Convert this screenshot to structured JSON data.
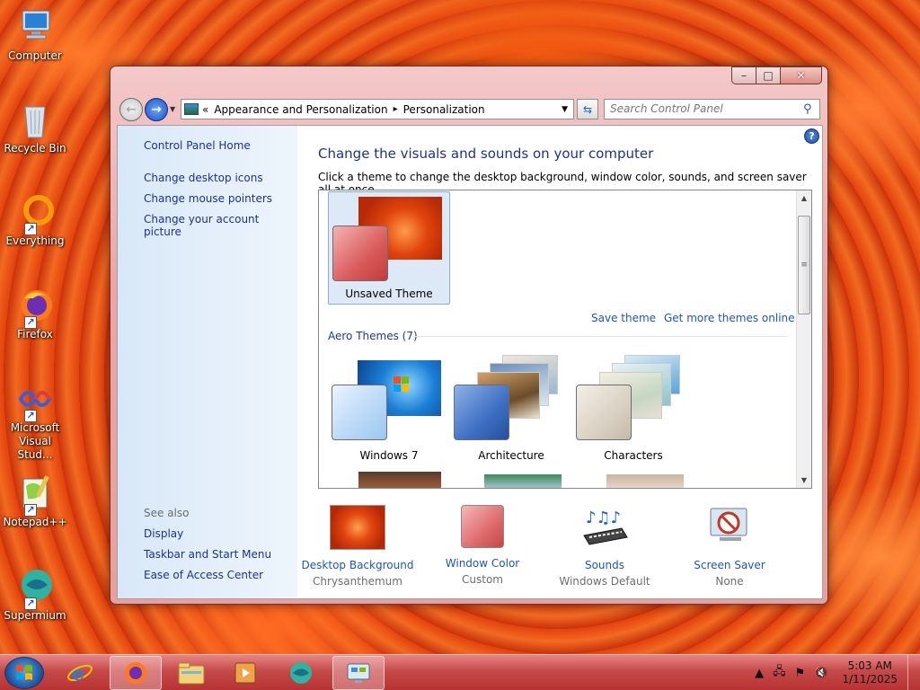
{
  "desktop": {
    "icons": [
      {
        "label": "Computer",
        "icon": "computer-icon"
      },
      {
        "label": "Recycle Bin",
        "icon": "recycle-bin-icon"
      },
      {
        "label": "Everything",
        "icon": "everything-icon"
      },
      {
        "label": "Firefox",
        "icon": "firefox-icon"
      },
      {
        "label_line1": "Microsoft",
        "label_line2": "Visual Stud...",
        "icon": "visual-studio-icon"
      },
      {
        "label": "Notepad++",
        "icon": "notepad-plus-plus-icon"
      },
      {
        "label": "Supermium",
        "icon": "supermium-icon"
      }
    ]
  },
  "window": {
    "controls": {
      "minimize": "–",
      "maximize": "□",
      "close": "✕"
    },
    "address": {
      "prefix": "«",
      "crumb1": "Appearance and Personalization",
      "separator": "▸",
      "crumb2": "Personalization"
    },
    "search_placeholder": "Search Control Panel",
    "sidebar": {
      "home": "Control Panel Home",
      "links": [
        "Change desktop icons",
        "Change mouse pointers",
        "Change your account picture"
      ],
      "see_also": "See also",
      "see_also_links": [
        "Display",
        "Taskbar and Start Menu",
        "Ease of Access Center"
      ]
    },
    "main": {
      "title": "Change the visuals and sounds on your computer",
      "description": "Click a theme to change the desktop background, window color, sounds, and screen saver all at once.",
      "unsaved_theme": "Unsaved Theme",
      "save_theme": "Save theme",
      "get_more_themes": "Get more themes online",
      "aero_group": "Aero Themes (7)",
      "aero_themes": [
        "Windows 7",
        "Architecture",
        "Characters"
      ]
    },
    "bottom": [
      {
        "label": "Desktop Background",
        "sub": "Chrysanthemum"
      },
      {
        "label": "Window Color",
        "sub": "Custom"
      },
      {
        "label": "Sounds",
        "sub": "Windows Default"
      },
      {
        "label": "Screen Saver",
        "sub": "None"
      }
    ]
  },
  "taskbar": {
    "time": "5:03 AM",
    "date": "1/11/2025",
    "apps": [
      "internet-explorer-icon",
      "firefox-icon",
      "file-explorer-icon",
      "media-player-icon",
      "supermium-icon",
      "control-panel-icon"
    ]
  },
  "colors": {
    "accent_link": "#1e56b3",
    "title_blue": "#1e3287",
    "window_frame": "#e9a7a7",
    "taskbar": "#c64a4a"
  }
}
